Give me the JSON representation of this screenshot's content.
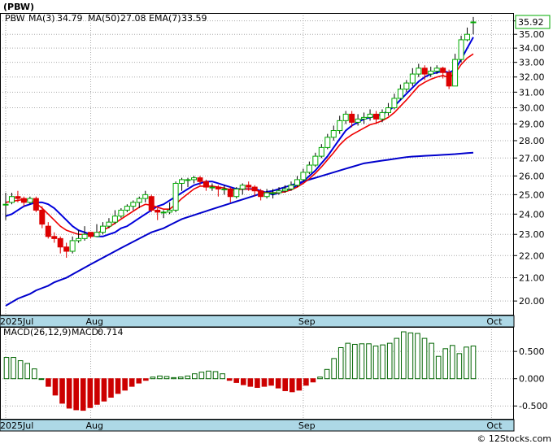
{
  "title": "(PBW)",
  "watermark": "© 12Stocks.com",
  "last_price_label": "35.92",
  "legend": {
    "symbol": "PBW",
    "ma3_label": "MA(3)",
    "ma3_value": "34.79",
    "ma50_label": "MA(50)",
    "ma50_value": "27.08",
    "ema7_label": "EMA(7)",
    "ema7_value": "33.59"
  },
  "macd_legend": {
    "label": "MACD(26,12,9)",
    "macd_label": "MACD:",
    "macd_value": "0.714"
  },
  "colors": {
    "band": "#add8e6",
    "grid": "#a9a9a9",
    "ma_short": "#0000dd",
    "ma_long": "#0000cc",
    "ema": "#ee0000",
    "up_candle": "#00aa00",
    "down_candle": "#dd0000",
    "macd_pos": "#006400",
    "macd_neg": "#cc0000",
    "last_price_box": "#00aa00"
  },
  "chart_data": [
    {
      "type": "candlestick",
      "title": "(PBW)",
      "ylim": [
        19.4,
        36.6
      ],
      "y_scale": "log",
      "yticks": [
        20,
        21,
        22,
        23,
        24,
        25,
        26,
        27,
        28,
        29,
        30,
        31,
        32,
        33,
        34,
        35,
        36
      ],
      "ytick_labels": [
        "20.00",
        "21.00",
        "22.00",
        "23.00",
        "24.00",
        "25.00",
        "26.00",
        "27.00",
        "28.00",
        "29.00",
        "30.00",
        "31.00",
        "32.00",
        "33.00",
        "34.00",
        "35.00",
        "36.00"
      ],
      "x_labels": [
        {
          "label": "2025Jul",
          "index": 0
        },
        {
          "label": "Aug",
          "index": 14
        },
        {
          "label": "Sep",
          "index": 49
        },
        {
          "label": "Oct",
          "index": 80
        }
      ],
      "candles": [
        [
          24.5,
          24.5,
          25.1,
          23.7
        ],
        [
          24.6,
          24.9,
          25.1,
          24.5
        ],
        [
          24.9,
          24.8,
          25.2,
          24.6
        ],
        [
          24.8,
          24.6,
          24.9,
          24.4
        ],
        [
          24.6,
          24.8,
          24.9,
          24.5
        ],
        [
          24.8,
          24.2,
          24.9,
          24.1
        ],
        [
          24.2,
          23.5,
          24.4,
          23.3
        ],
        [
          23.4,
          22.9,
          23.6,
          22.8
        ],
        [
          22.9,
          22.8,
          23.1,
          22.6
        ],
        [
          22.8,
          22.4,
          22.9,
          22.1
        ],
        [
          22.4,
          22.2,
          22.6,
          21.9
        ],
        [
          22.2,
          22.7,
          22.9,
          22.1
        ],
        [
          22.7,
          22.8,
          23.2,
          22.6
        ],
        [
          22.8,
          23.0,
          23.4,
          22.7
        ],
        [
          23.1,
          22.9,
          23.1,
          22.8
        ],
        [
          22.9,
          23.1,
          23.5,
          22.9
        ],
        [
          23.1,
          23.4,
          23.6,
          23.0
        ],
        [
          23.4,
          23.6,
          23.8,
          23.3
        ],
        [
          23.6,
          23.9,
          24.2,
          23.5
        ],
        [
          23.9,
          24.2,
          24.3,
          23.8
        ],
        [
          24.2,
          24.4,
          24.5,
          24.1
        ],
        [
          24.4,
          24.6,
          24.7,
          24.2
        ],
        [
          24.6,
          24.8,
          24.9,
          24.3
        ],
        [
          24.8,
          25.0,
          25.2,
          24.6
        ],
        [
          24.9,
          24.2,
          25.0,
          24.1
        ],
        [
          24.2,
          24.1,
          24.3,
          23.7
        ],
        [
          24.1,
          24.1,
          24.2,
          23.8
        ],
        [
          24.1,
          24.2,
          24.6,
          24.0
        ],
        [
          24.2,
          25.6,
          25.7,
          24.1
        ],
        [
          25.6,
          25.8,
          25.9,
          25.2
        ],
        [
          25.8,
          25.8,
          25.9,
          25.4
        ],
        [
          25.8,
          25.9,
          26.0,
          25.6
        ],
        [
          25.9,
          25.7,
          26.0,
          25.5
        ],
        [
          25.7,
          25.4,
          25.8,
          25.2
        ],
        [
          25.4,
          25.4,
          25.6,
          25.2
        ],
        [
          25.4,
          25.3,
          25.5,
          24.9
        ],
        [
          25.3,
          25.3,
          25.5,
          25.0
        ],
        [
          25.3,
          24.9,
          25.4,
          24.6
        ],
        [
          24.9,
          25.3,
          25.4,
          24.8
        ],
        [
          25.3,
          25.5,
          25.6,
          25.0
        ],
        [
          25.5,
          25.4,
          25.7,
          25.2
        ],
        [
          25.4,
          25.2,
          25.5,
          24.9
        ],
        [
          25.2,
          24.9,
          25.3,
          24.7
        ],
        [
          24.9,
          25.1,
          25.3,
          24.8
        ],
        [
          25.1,
          25.1,
          25.3,
          24.8
        ],
        [
          25.1,
          25.2,
          25.4,
          25.0
        ],
        [
          25.2,
          25.3,
          25.5,
          25.1
        ],
        [
          25.3,
          25.5,
          25.7,
          25.2
        ],
        [
          25.5,
          25.8,
          26.0,
          25.4
        ],
        [
          25.8,
          26.2,
          26.4,
          25.7
        ],
        [
          26.2,
          26.6,
          26.8,
          26.1
        ],
        [
          26.6,
          27.1,
          27.3,
          26.5
        ],
        [
          27.1,
          27.6,
          27.8,
          27.0
        ],
        [
          27.6,
          28.2,
          28.4,
          27.5
        ],
        [
          28.2,
          28.6,
          28.9,
          28.0
        ],
        [
          28.6,
          29.2,
          29.5,
          28.4
        ],
        [
          29.2,
          29.6,
          29.8,
          29.0
        ],
        [
          29.6,
          29.1,
          29.8,
          28.8
        ],
        [
          29.1,
          29.3,
          29.6,
          28.9
        ],
        [
          29.3,
          29.4,
          29.7,
          29.0
        ],
        [
          29.4,
          29.6,
          29.9,
          29.2
        ],
        [
          29.6,
          29.3,
          29.8,
          29.0
        ],
        [
          29.3,
          29.7,
          29.9,
          29.1
        ],
        [
          29.7,
          30.0,
          30.3,
          29.5
        ],
        [
          30.0,
          30.6,
          30.9,
          29.9
        ],
        [
          30.6,
          31.2,
          31.5,
          30.5
        ],
        [
          31.2,
          31.6,
          31.8,
          31.0
        ],
        [
          31.6,
          32.2,
          32.6,
          31.4
        ],
        [
          32.2,
          32.6,
          32.9,
          32.0
        ],
        [
          32.6,
          32.2,
          32.8,
          31.8
        ],
        [
          32.2,
          32.4,
          32.7,
          32.0
        ],
        [
          32.4,
          32.6,
          32.8,
          32.2
        ],
        [
          32.6,
          32.3,
          32.7,
          31.9
        ],
        [
          32.3,
          31.4,
          32.5,
          31.2
        ],
        [
          31.4,
          33.2,
          33.6,
          31.4
        ],
        [
          33.2,
          34.6,
          34.9,
          33.0
        ],
        [
          34.6,
          35.0,
          35.5,
          34.5
        ],
        [
          35.92,
          35.92,
          36.3,
          35.0
        ]
      ],
      "series": [
        {
          "name": "MA(3)",
          "values": [
            23.9,
            24.0,
            24.2,
            24.4,
            24.5,
            24.6,
            24.6,
            24.5,
            24.3,
            24.0,
            23.7,
            23.4,
            23.2,
            23.1,
            23.0,
            22.9,
            22.9,
            23.0,
            23.1,
            23.3,
            23.4,
            23.6,
            23.8,
            24.0,
            24.2,
            24.4,
            24.5,
            24.7,
            24.9,
            25.1,
            25.3,
            25.5,
            25.6,
            25.7,
            25.7,
            25.6,
            25.5,
            25.4,
            25.3,
            25.3,
            25.3,
            25.3,
            25.2,
            25.1,
            25.0,
            25.1,
            25.2,
            25.3,
            25.5,
            25.7,
            26.0,
            26.3,
            26.7,
            27.1,
            27.6,
            28.1,
            28.6,
            28.9,
            29.1,
            29.3,
            29.4,
            29.5,
            29.6,
            29.8,
            30.1,
            30.5,
            30.9,
            31.3,
            31.7,
            32.0,
            32.2,
            32.3,
            32.4,
            32.3,
            32.5,
            33.2,
            34.0,
            34.79
          ]
        },
        {
          "name": "MA(50)",
          "values": [
            19.8,
            19.95,
            20.1,
            20.2,
            20.3,
            20.45,
            20.55,
            20.65,
            20.8,
            20.9,
            21.0,
            21.15,
            21.3,
            21.45,
            21.6,
            21.75,
            21.9,
            22.05,
            22.2,
            22.35,
            22.5,
            22.65,
            22.8,
            22.95,
            23.1,
            23.2,
            23.3,
            23.45,
            23.6,
            23.75,
            23.85,
            23.95,
            24.05,
            24.15,
            24.25,
            24.35,
            24.45,
            24.55,
            24.65,
            24.75,
            24.85,
            24.95,
            25.05,
            25.15,
            25.2,
            25.3,
            25.4,
            25.5,
            25.6,
            25.7,
            25.8,
            25.9,
            26.0,
            26.1,
            26.2,
            26.3,
            26.4,
            26.5,
            26.6,
            26.7,
            26.75,
            26.8,
            26.85,
            26.9,
            26.95,
            27.0,
            27.05,
            27.08,
            27.1,
            27.12,
            27.14,
            27.16,
            27.18,
            27.2,
            27.22,
            27.25,
            27.28,
            27.3
          ]
        },
        {
          "name": "EMA(7)",
          "values": [
            24.6,
            24.65,
            24.7,
            24.75,
            24.7,
            24.55,
            24.3,
            24.0,
            23.7,
            23.4,
            23.2,
            23.1,
            23.0,
            23.0,
            23.0,
            23.05,
            23.2,
            23.35,
            23.55,
            23.75,
            23.95,
            24.15,
            24.35,
            24.5,
            24.45,
            24.35,
            24.25,
            24.25,
            24.5,
            24.8,
            25.05,
            25.3,
            25.45,
            25.45,
            25.45,
            25.4,
            25.35,
            25.25,
            25.25,
            25.3,
            25.3,
            25.25,
            25.15,
            25.1,
            25.1,
            25.1,
            25.15,
            25.25,
            25.4,
            25.6,
            25.85,
            26.15,
            26.5,
            26.9,
            27.3,
            27.75,
            28.1,
            28.35,
            28.55,
            28.75,
            28.95,
            29.05,
            29.2,
            29.4,
            29.7,
            30.1,
            30.5,
            30.95,
            31.4,
            31.65,
            31.85,
            32.0,
            32.1,
            31.95,
            32.25,
            32.85,
            33.3,
            33.59
          ]
        }
      ]
    },
    {
      "type": "bar",
      "title": "MACD(26,12,9)",
      "ylim": [
        -0.75,
        0.95
      ],
      "yticks": [
        -0.5,
        0.0,
        0.5
      ],
      "ytick_labels": [
        "-0.500",
        "0.000",
        "0.500"
      ],
      "x_labels": [
        {
          "label": "2025Jul",
          "index": 0
        },
        {
          "label": "Aug",
          "index": 14
        },
        {
          "label": "Sep",
          "index": 49
        },
        {
          "label": "Oct",
          "index": 80
        }
      ],
      "values": [
        0.39,
        0.39,
        0.33,
        0.28,
        0.18,
        0.0,
        -0.14,
        -0.3,
        -0.45,
        -0.54,
        -0.57,
        -0.58,
        -0.53,
        -0.47,
        -0.41,
        -0.34,
        -0.27,
        -0.21,
        -0.14,
        -0.08,
        -0.03,
        0.03,
        0.05,
        0.04,
        0.02,
        0.03,
        0.05,
        0.09,
        0.12,
        0.14,
        0.13,
        0.09,
        -0.03,
        -0.07,
        -0.11,
        -0.14,
        -0.16,
        -0.14,
        -0.12,
        -0.17,
        -0.22,
        -0.24,
        -0.21,
        -0.12,
        -0.06,
        0.03,
        0.17,
        0.37,
        0.57,
        0.65,
        0.63,
        0.64,
        0.64,
        0.6,
        0.62,
        0.65,
        0.74,
        0.86,
        0.84,
        0.83,
        0.74,
        0.65,
        0.41,
        0.55,
        0.61,
        0.46,
        0.58,
        0.6
      ]
    }
  ]
}
